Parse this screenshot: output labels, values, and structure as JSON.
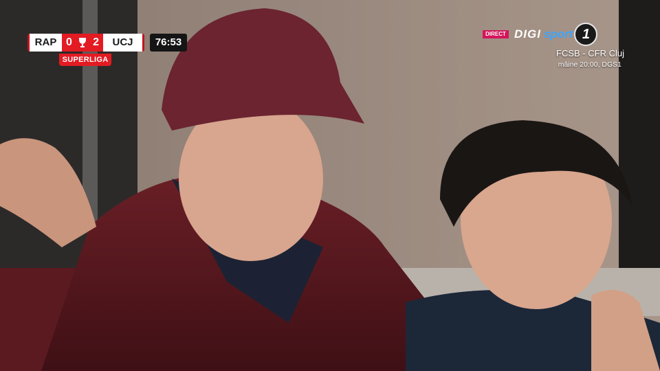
{
  "scoreboard": {
    "home_team": "RAP",
    "home_score": "0",
    "away_score": "2",
    "away_team": "UCJ",
    "clock": "76:53",
    "league": "SUPERLIGA"
  },
  "channel": {
    "live_badge": "DIRECT",
    "brand_digi": "DIGI",
    "brand_sport": "sport",
    "channel_number": "1",
    "next_match": "FCSB - CFR Cluj",
    "next_match_time": "mâine 20:00, DGS1"
  },
  "colors": {
    "scoreboard_red": "#e31b23",
    "live_badge_pink": "#d4145a",
    "sport_blue": "#3da5ff"
  },
  "icons": [
    "trophy-icon",
    "channel-number-badge"
  ]
}
